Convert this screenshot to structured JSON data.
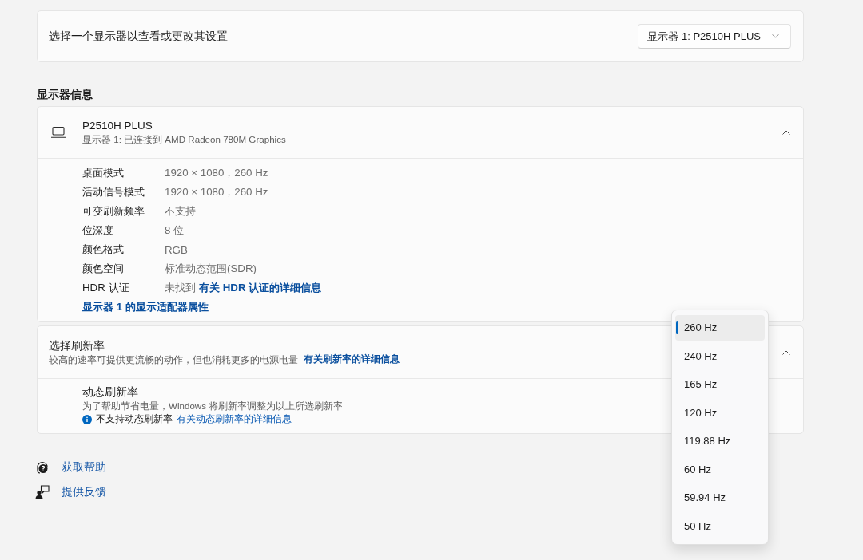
{
  "display_selector": {
    "label": "选择一个显示器以查看或更改其设置",
    "value": "显示器 1: P2510H PLUS"
  },
  "display_info": {
    "heading": "显示器信息",
    "monitor": {
      "name": "P2510H PLUS",
      "subtitle": "显示器 1: 已连接到 AMD Radeon 780M Graphics",
      "expanded": true
    },
    "properties": [
      {
        "label": "桌面模式",
        "value": "1920 × 1080，260 Hz"
      },
      {
        "label": "活动信号模式",
        "value": "1920 × 1080，260 Hz"
      },
      {
        "label": "可变刷新频率",
        "value": "不支持"
      },
      {
        "label": "位深度",
        "value": "8 位"
      },
      {
        "label": "颜色格式",
        "value": "RGB"
      },
      {
        "label": "颜色空间",
        "value": "标准动态范围(SDR)"
      },
      {
        "label": "HDR 认证",
        "value": "未找到",
        "link": "有关 HDR 认证的详细信息"
      }
    ],
    "adapter_link": "显示器 1 的显示适配器属性"
  },
  "refresh_rate": {
    "title": "选择刷新率",
    "description": "较高的速率可提供更流畅的动作，但也消耗更多的电源电量",
    "link": "有关刷新率的详细信息",
    "expanded": true,
    "dynamic_refresh": {
      "title": "动态刷新率",
      "description": "为了帮助节省电量，Windows 将刷新率调整为以上所选刷新率",
      "notice": "不支持动态刷新率",
      "link": "有关动态刷新率的详细信息"
    },
    "options": [
      {
        "label": "260 Hz",
        "selected": true
      },
      {
        "label": "240 Hz",
        "selected": false
      },
      {
        "label": "165 Hz",
        "selected": false
      },
      {
        "label": "120 Hz",
        "selected": false
      },
      {
        "label": "119.88 Hz",
        "selected": false
      },
      {
        "label": "60 Hz",
        "selected": false
      },
      {
        "label": "59.94 Hz",
        "selected": false
      },
      {
        "label": "50 Hz",
        "selected": false
      }
    ]
  },
  "help_links": [
    {
      "kind": "help",
      "label": "获取帮助"
    },
    {
      "kind": "feedback",
      "label": "提供反馈"
    }
  ]
}
